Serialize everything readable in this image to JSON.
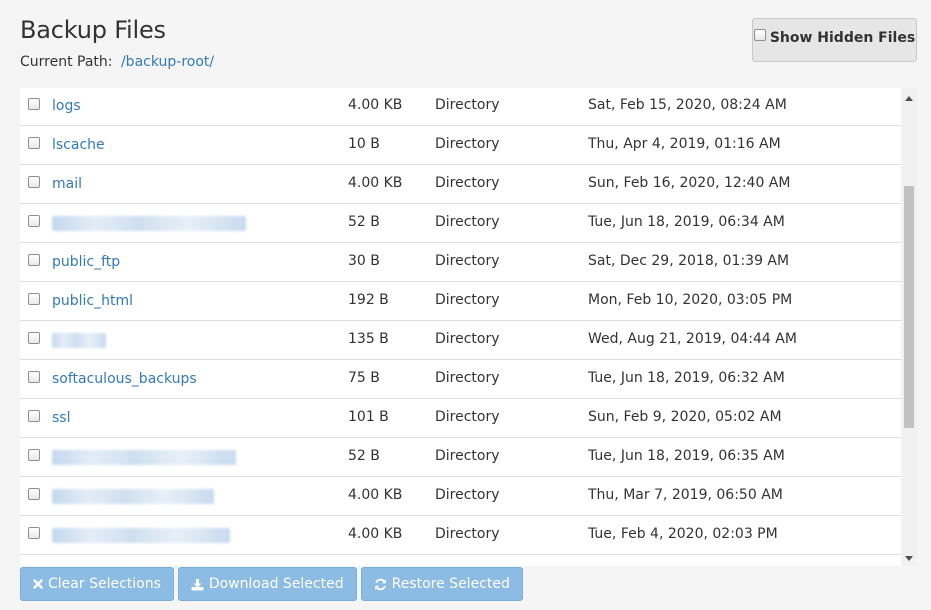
{
  "header": {
    "title": "Backup Files",
    "path_label": "Current Path:",
    "path_value": "/backup-root/"
  },
  "toolbar": {
    "show_hidden_label": "Show Hidden Files"
  },
  "files": [
    {
      "name": "logs",
      "size": "4.00 KB",
      "type": "Directory",
      "modified": "Sat, Feb 15, 2020, 08:24 AM",
      "redacted": false
    },
    {
      "name": "lscache",
      "size": "10 B",
      "type": "Directory",
      "modified": "Thu, Apr 4, 2019, 01:16 AM",
      "redacted": false
    },
    {
      "name": "mail",
      "size": "4.00 KB",
      "type": "Directory",
      "modified": "Sun, Feb 16, 2020, 12:40 AM",
      "redacted": false
    },
    {
      "name": "",
      "size": "52 B",
      "type": "Directory",
      "modified": "Tue, Jun 18, 2019, 06:34 AM",
      "redacted": true
    },
    {
      "name": "public_ftp",
      "size": "30 B",
      "type": "Directory",
      "modified": "Sat, Dec 29, 2018, 01:39 AM",
      "redacted": false
    },
    {
      "name": "public_html",
      "size": "192 B",
      "type": "Directory",
      "modified": "Mon, Feb 10, 2020, 03:05 PM",
      "redacted": false
    },
    {
      "name": "",
      "size": "135 B",
      "type": "Directory",
      "modified": "Wed, Aug 21, 2019, 04:44 AM",
      "redacted": true
    },
    {
      "name": "softaculous_backups",
      "size": "75 B",
      "type": "Directory",
      "modified": "Tue, Jun 18, 2019, 06:32 AM",
      "redacted": false
    },
    {
      "name": "ssl",
      "size": "101 B",
      "type": "Directory",
      "modified": "Sun, Feb 9, 2020, 05:02 AM",
      "redacted": false
    },
    {
      "name": "",
      "size": "52 B",
      "type": "Directory",
      "modified": "Tue, Jun 18, 2019, 06:35 AM",
      "redacted": true
    },
    {
      "name": "",
      "size": "4.00 KB",
      "type": "Directory",
      "modified": "Thu, Mar 7, 2019, 06:50 AM",
      "redacted": true
    },
    {
      "name": "",
      "size": "4.00 KB",
      "type": "Directory",
      "modified": "Tue, Feb 4, 2020, 02:03 PM",
      "redacted": true
    }
  ],
  "actions": {
    "clear_label": "Clear Selections",
    "download_label": "Download Selected",
    "restore_label": "Restore Selected",
    "clear_icon": "times-icon",
    "download_icon": "download-icon",
    "restore_icon": "refresh-icon"
  },
  "colors": {
    "link": "#337ab7",
    "button_bg": "#8cbbe4",
    "row_border": "#dddddd"
  }
}
